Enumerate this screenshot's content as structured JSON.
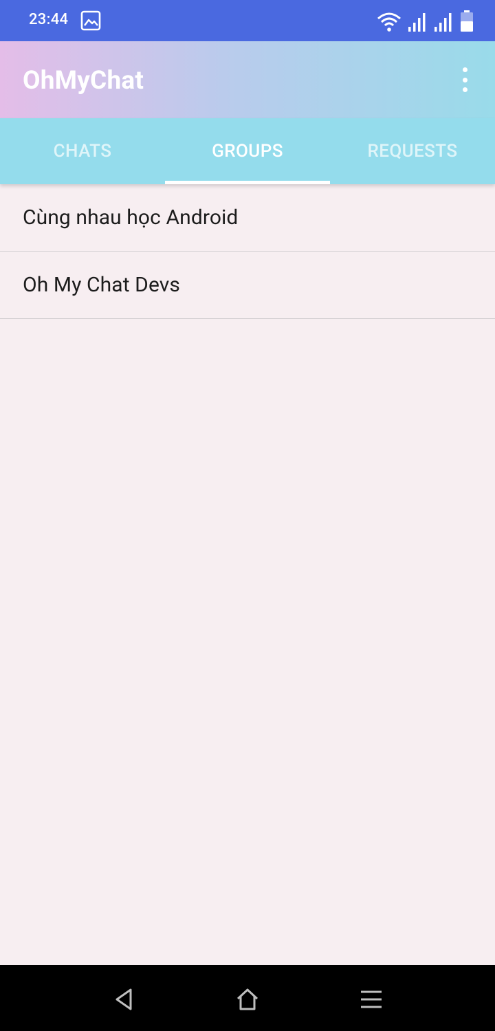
{
  "status_bar": {
    "time": "23:44",
    "icons": [
      "gallery-icon",
      "wifi-icon",
      "signal-icon",
      "signal-icon",
      "battery-icon"
    ]
  },
  "app_bar": {
    "title": "OhMyChat",
    "menu_icon": "more-vert-icon"
  },
  "tabs": [
    {
      "label": "CHATS",
      "active": false
    },
    {
      "label": "GROUPS",
      "active": true
    },
    {
      "label": "REQUESTS",
      "active": false
    }
  ],
  "groups": [
    {
      "name": "Cùng nhau học Android"
    },
    {
      "name": "Oh My Chat Devs"
    }
  ],
  "nav_bar": {
    "icons": [
      "back-icon",
      "home-icon",
      "recent-apps-icon"
    ]
  },
  "colors": {
    "status_bar": "#4a69e0",
    "tab_bar": "#94dcec",
    "background": "#f7eef1"
  }
}
